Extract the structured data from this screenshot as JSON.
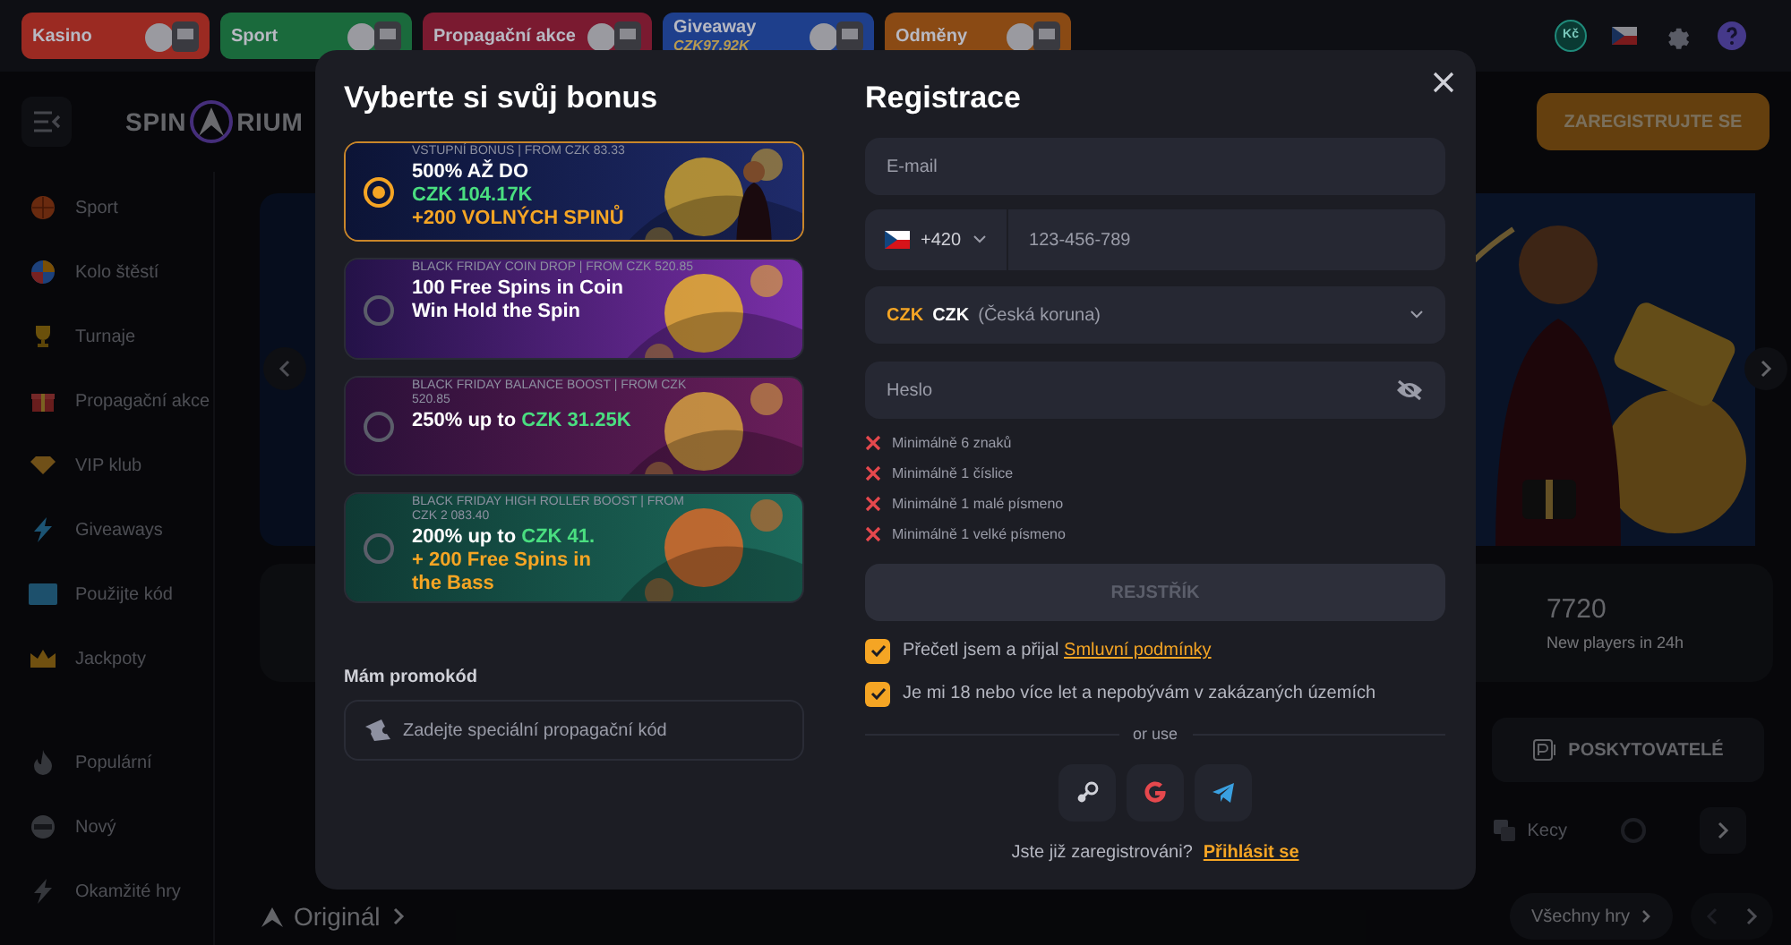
{
  "top_tabs": [
    {
      "label": "Kasino",
      "color": "#9b2a22"
    },
    {
      "label": "Sport",
      "color": "#1a6a3c"
    },
    {
      "label": "Propagační akce",
      "color": "#7a1a30"
    },
    {
      "label": "Giveaway",
      "sub": "CZK97.92K",
      "color": "#1e3f8c"
    },
    {
      "label": "Odměny",
      "color": "#8a4a14"
    }
  ],
  "header_tools": {
    "currency_symbol": "Kč"
  },
  "logo": {
    "left": "SPIN",
    "right": "RIUM"
  },
  "register_button": "ZAREGISTRUJTE SE",
  "sidebar": {
    "groups": [
      [
        {
          "label": "Sport"
        },
        {
          "label": "Kolo štěstí"
        },
        {
          "label": "Turnaje"
        },
        {
          "label": "Propagační akce"
        },
        {
          "label": "VIP klub"
        },
        {
          "label": "Giveaways"
        },
        {
          "label": "Použijte kód"
        },
        {
          "label": "Jackpoty"
        }
      ],
      [
        {
          "label": "Populární"
        },
        {
          "label": "Nový"
        },
        {
          "label": "Okamžité hry"
        }
      ]
    ]
  },
  "stats": {
    "value": "7720",
    "label": "New players in 24h"
  },
  "providers_button": "POSKYTOVATELÉ",
  "category": "Kecy",
  "sections": {
    "originals": "Originál",
    "all_games": "Všechny hry"
  },
  "modal": {
    "bonus_title": "Vyberte si svůj bonus",
    "bonuses": [
      {
        "caption": "VSTUPNÍ BONUS | FROM CZK 83.33",
        "selected": true,
        "lines": [
          [
            {
              "text": "500% AŽ DO",
              "color": "#ffffff"
            }
          ],
          [
            {
              "text": "CZK 104.17K",
              "color": "#4ade80"
            }
          ],
          [
            {
              "text": "+200 VOLNÝCH SPINŮ",
              "color": "#f5a524"
            }
          ]
        ]
      },
      {
        "caption": "BLACK FRIDAY COIN DROP | FROM CZK 520.85",
        "selected": false,
        "lines": [
          [
            {
              "text": "100 Free Spins in Coin",
              "color": "#ffffff"
            }
          ],
          [
            {
              "text": "Win Hold the Spin",
              "color": "#ffffff"
            }
          ]
        ]
      },
      {
        "caption": "BLACK FRIDAY BALANCE BOOST | FROM CZK 520.85",
        "selected": false,
        "lines": [
          [
            {
              "text": "250% up to ",
              "color": "#ffffff"
            },
            {
              "text": "CZK 31.25K",
              "color": "#4ade80"
            }
          ]
        ]
      },
      {
        "caption": "BLACK FRIDAY HIGH ROLLER BOOST | FROM CZK 2 083.40",
        "selected": false,
        "lines": [
          [
            {
              "text": "200% up to ",
              "color": "#ffffff"
            },
            {
              "text": "CZK 41.",
              "color": "#4ade80"
            }
          ],
          [
            {
              "text": "+ 200 Free Spins in",
              "color": "#f5a524"
            }
          ],
          [
            {
              "text": "the Bass",
              "color": "#f5a524"
            }
          ]
        ]
      }
    ],
    "promo_label": "Mám promokód",
    "promo_placeholder": "Zadejte speciální propagační kód",
    "register_title": "Registrace",
    "email_placeholder": "E-mail",
    "phone_code": "+420",
    "phone_placeholder": "123-456-789",
    "currency": {
      "code": "CZK",
      "name": "CZK",
      "full": "(Česká koruna)"
    },
    "password_placeholder": "Heslo",
    "rules": [
      {
        "text": "Minimálně 6 znaků",
        "met": false
      },
      {
        "text": "Minimálně 1 číslice",
        "met": false
      },
      {
        "text": "Minimálně 1 malé písmeno",
        "met": false
      },
      {
        "text": "Minimálně 1 velké písmeno",
        "met": false
      }
    ],
    "submit": {
      "label": "REJSTŘÍK",
      "disabled": true
    },
    "consents": [
      {
        "text": "Přečetl jsem a přijal ",
        "link": "Smluvní podmínky",
        "checked": true
      },
      {
        "text": "Je mi 18 nebo více let a nepobývám v zakázaných územích",
        "checked": true
      }
    ],
    "or_use": "or use",
    "login_prompt": "Jste již zaregistrováni?",
    "login_link": "Přihlásit se"
  }
}
